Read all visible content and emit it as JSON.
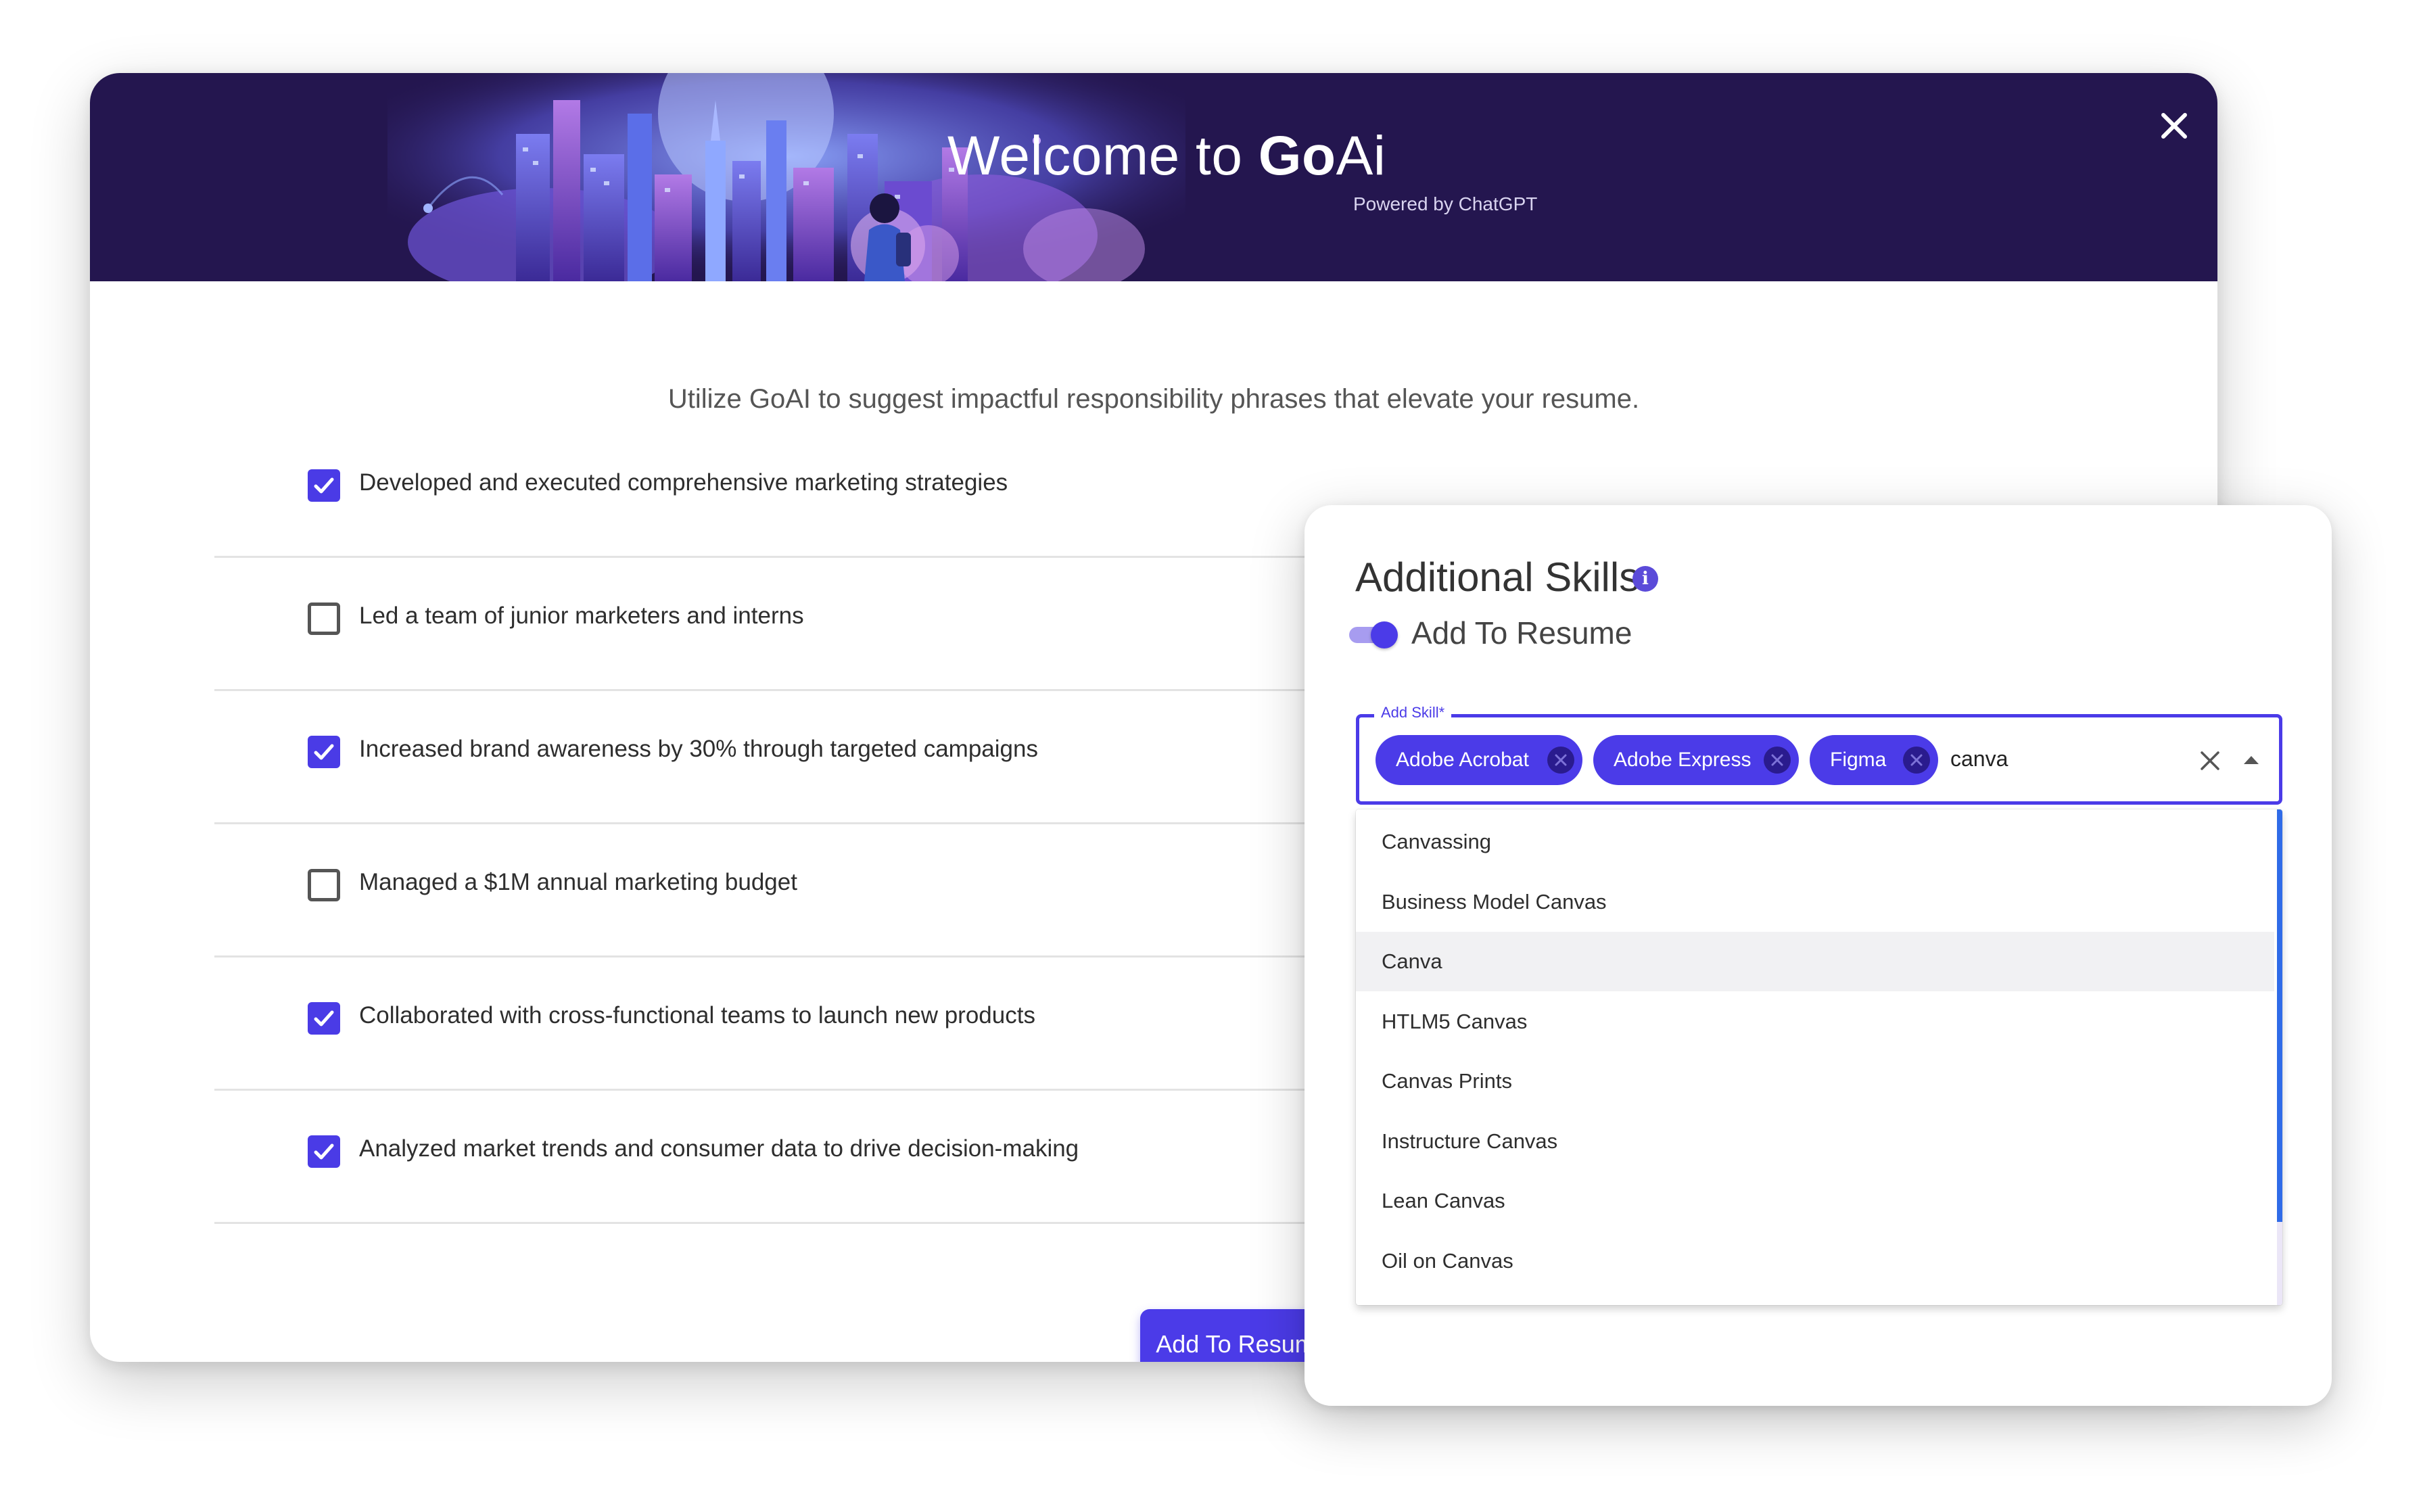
{
  "modal": {
    "title_prefix": "Welcome to ",
    "title_brand_bold": "Go",
    "title_brand_rest": "Ai",
    "powered_by": "Powered by ChatGPT",
    "intro": "Utilize GoAI to suggest impactful responsibility phrases that elevate your resume.",
    "responsibilities": [
      {
        "text": "Developed and executed comprehensive marketing strategies",
        "checked": true
      },
      {
        "text": "Led a team of junior marketers and interns",
        "checked": false
      },
      {
        "text": "Increased brand awareness by 30% through targeted campaigns",
        "checked": true
      },
      {
        "text": "Managed a $1M annual marketing budget",
        "checked": false
      },
      {
        "text": "Collaborated with cross-functional teams to launch new products",
        "checked": true
      },
      {
        "text": "Analyzed market trends and consumer data to drive decision-making",
        "checked": true
      }
    ],
    "add_button": "Add To Resume"
  },
  "skills_panel": {
    "title": "Additional Skills",
    "info_icon": "info-icon",
    "toggle_label": "Add To Resume",
    "toggle_on": true,
    "field_label": "Add Skill*",
    "chips": [
      "Adobe Acrobat",
      "Adobe Express",
      "Figma"
    ],
    "input_value": "canva",
    "options": [
      "Canvassing",
      "Business Model Canvas",
      "Canva",
      "HTLM5 Canvas",
      "Canvas Prints",
      "Instructure Canvas",
      "Lean Canvas",
      "Oil on Canvas"
    ],
    "highlighted_option": "Canva"
  },
  "colors": {
    "accent": "#4b3be8",
    "banner_bg": "#24164f",
    "chip_close": "#2a1b8e",
    "scrollbar": "#2f6be8"
  }
}
